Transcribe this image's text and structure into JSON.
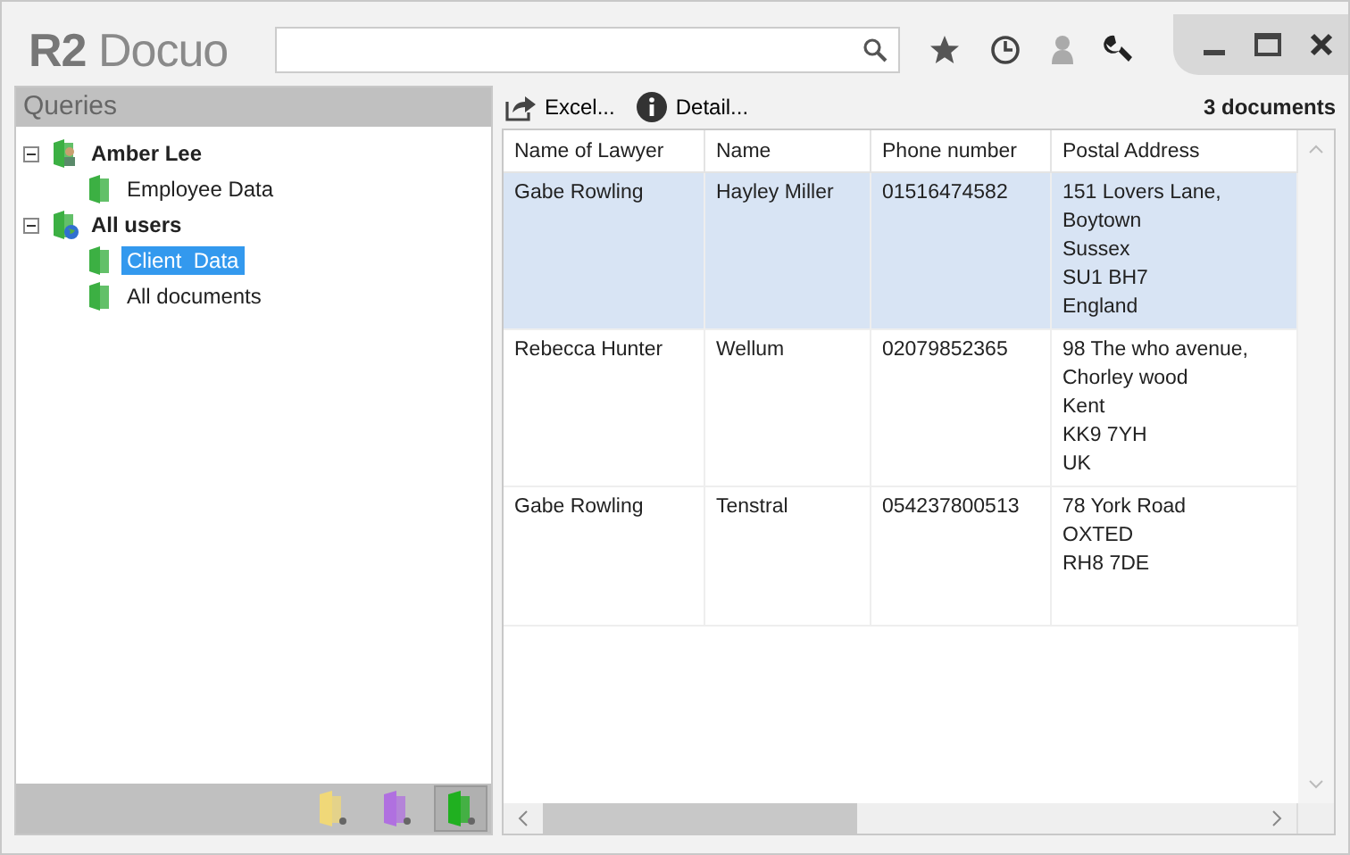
{
  "app": {
    "logo": "**R2** Docuo"
  },
  "queries": {
    "title": "Queries",
    "tree": [
      {
        "label": "Amber Lee",
        "kind": "user",
        "bold": true,
        "expanded": true,
        "selected": false,
        "children": [
          {
            "label": "Employee Data",
            "kind": "folder",
            "bold": false,
            "selected": false
          }
        ]
      },
      {
        "label": "All users",
        "kind": "globe",
        "bold": true,
        "expanded": true,
        "selected": false,
        "children": [
          {
            "label": "Client  Data",
            "kind": "folder",
            "bold": false,
            "selected": true
          },
          {
            "label": "All documents",
            "kind": "folder",
            "bold": false,
            "selected": false
          }
        ]
      }
    ],
    "folders": [
      {
        "color": "#f0d878",
        "selected": false
      },
      {
        "color": "#b070e0",
        "selected": false
      },
      {
        "color": "#20b020",
        "selected": true
      }
    ]
  },
  "toolbar": {
    "excel": "Excel...",
    "detail": "Detail...",
    "count": "3 documents"
  },
  "table": {
    "columns": [
      "Name of Lawyer",
      "Name",
      "Phone number",
      "Postal Address"
    ],
    "rows": [
      {
        "selected": true,
        "cells": [
          "Gabe Rowling",
          "Hayley Miller",
          "01516474582",
          "151 Lovers Lane,\nBoytown\nSussex\nSU1 BH7\nEngland"
        ]
      },
      {
        "selected": false,
        "cells": [
          "Rebecca Hunter",
          "Wellum",
          "02079852365",
          "98 The who avenue,\nChorley wood\nKent\nKK9 7YH\nUK"
        ]
      },
      {
        "selected": false,
        "cells": [
          "Gabe Rowling",
          "Tenstral",
          "054237800513",
          "78 York Road\nOXTED\nRH8 7DE"
        ]
      }
    ]
  }
}
